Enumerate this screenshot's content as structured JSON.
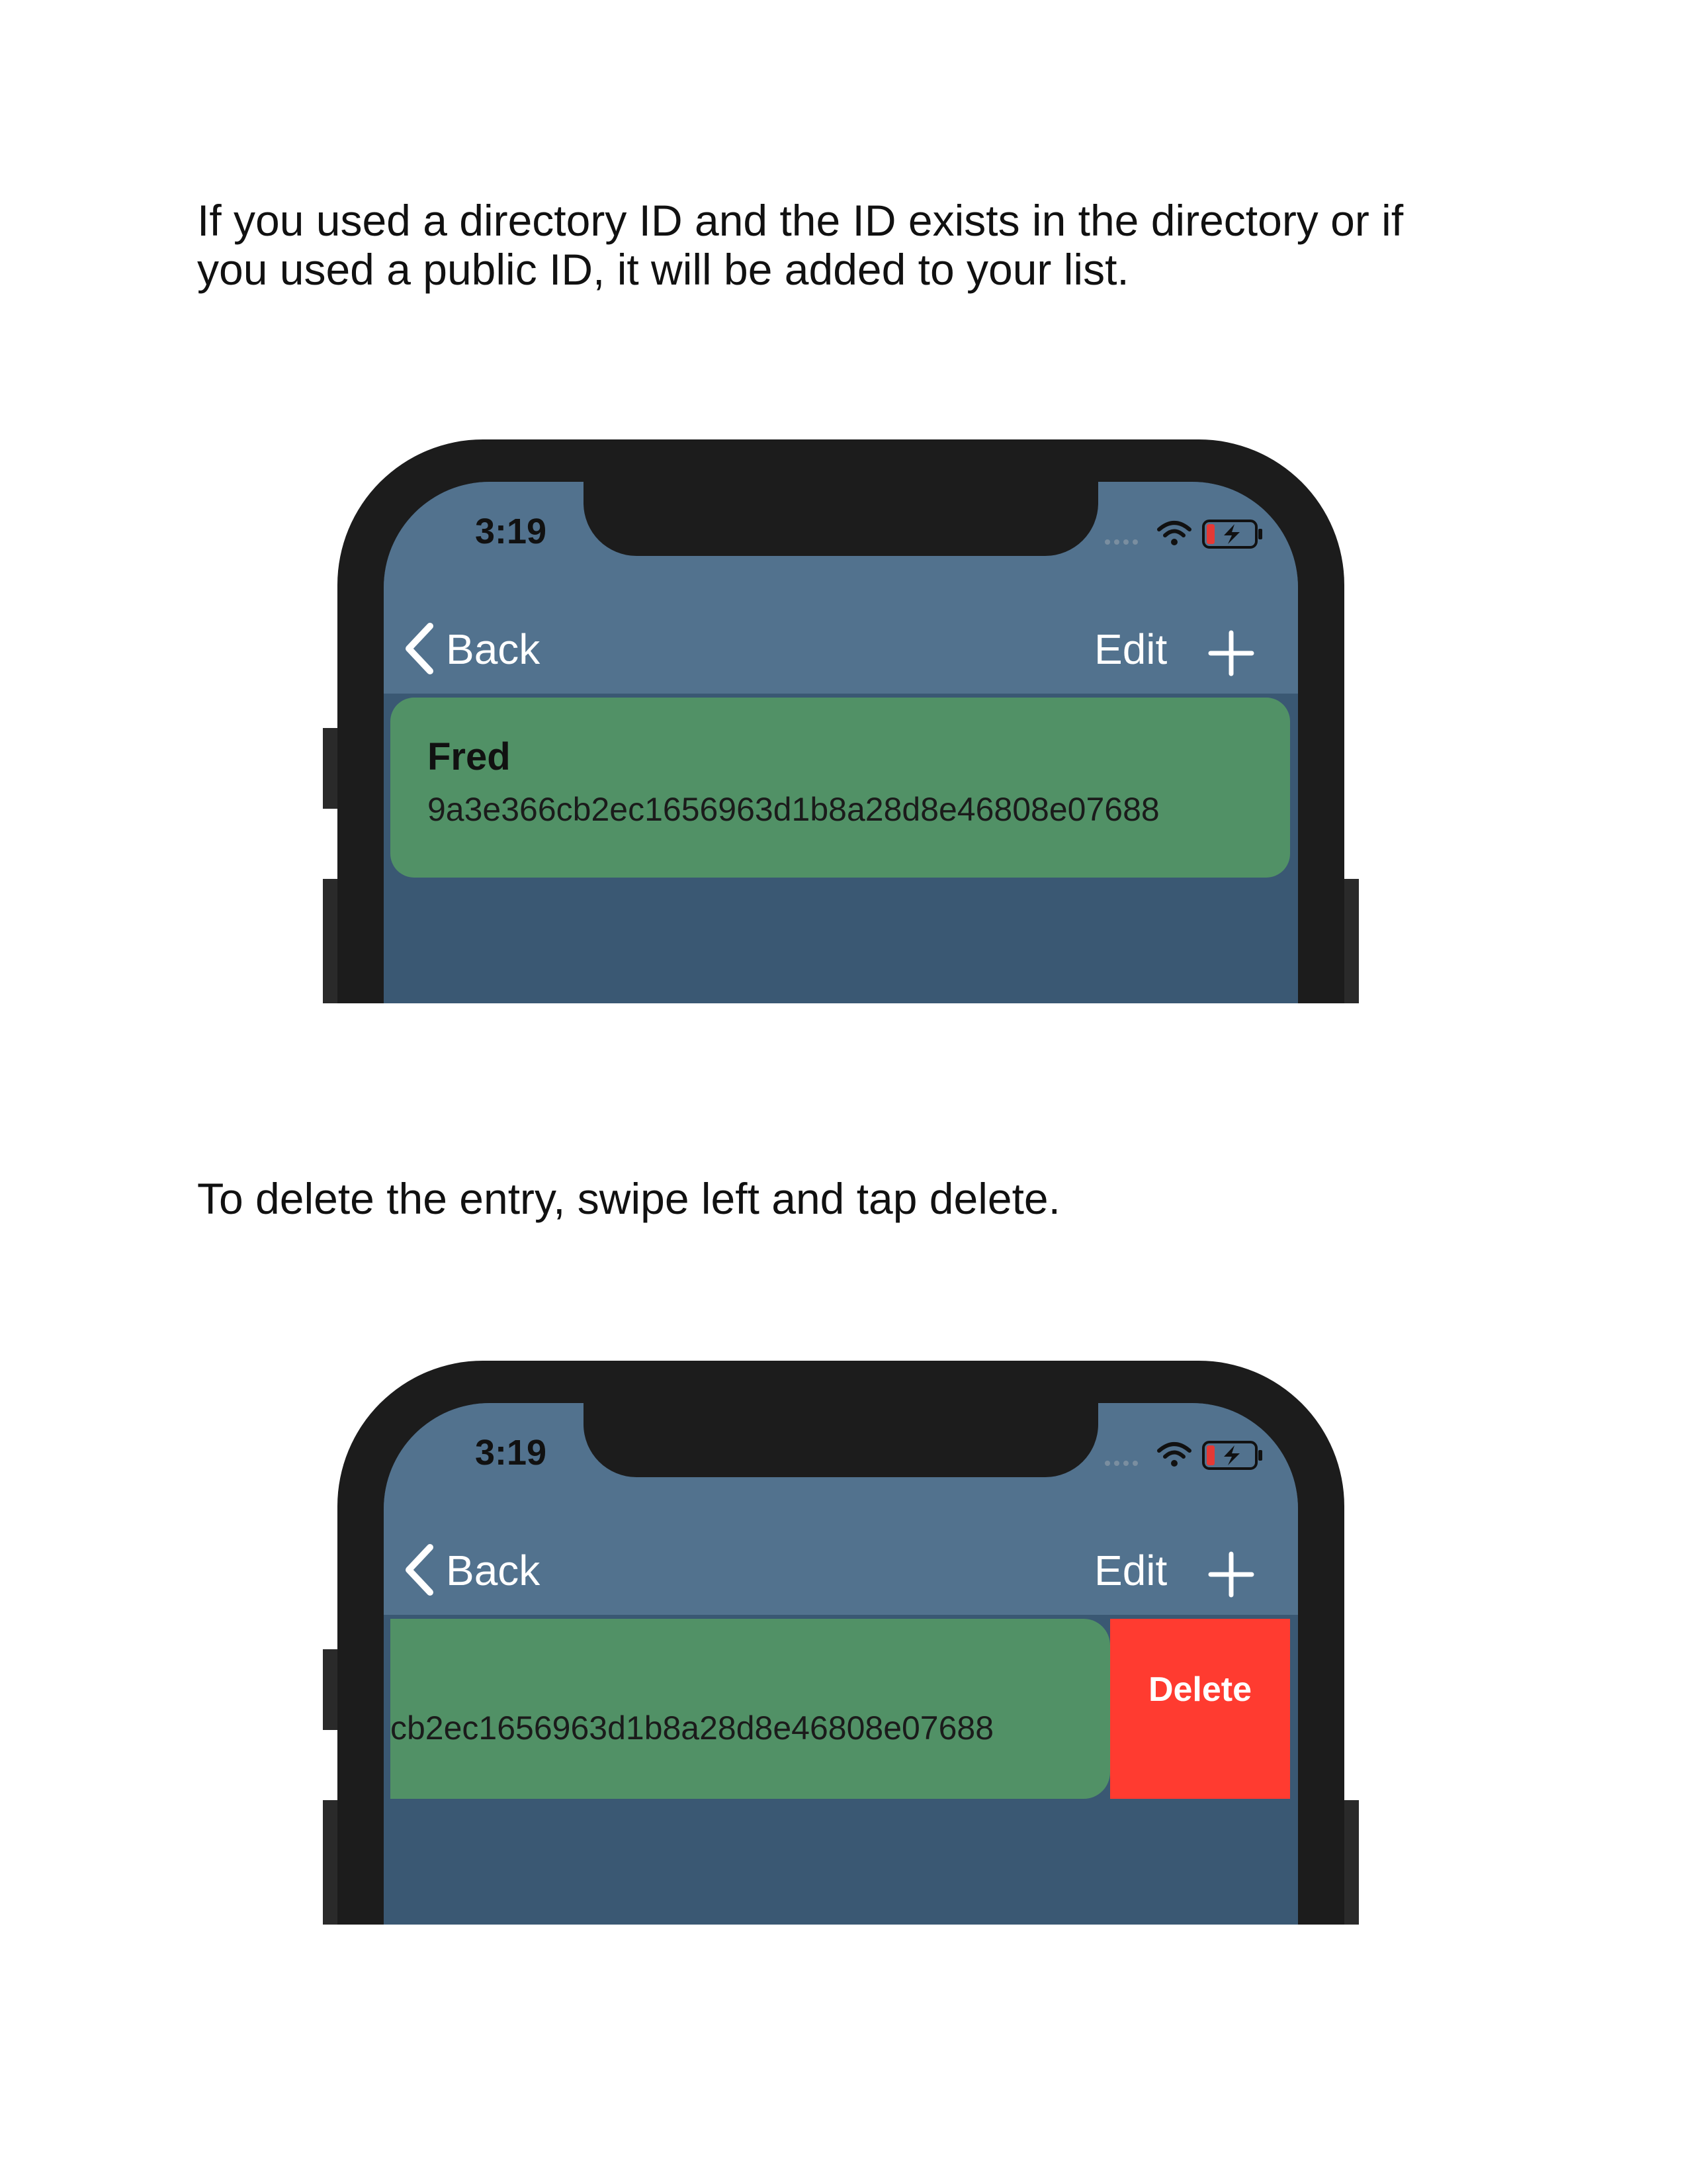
{
  "instructions": {
    "step1_line1": "If you used a directory ID and the ID exists in the directory or if",
    "step1_line2": "you used a public ID, it will be added to your list.",
    "step2": "To delete the entry, swipe left and tap delete."
  },
  "phone1": {
    "status_time": "3:19",
    "nav": {
      "back_label": "Back",
      "edit_label": "Edit"
    },
    "entry": {
      "name": "Fred",
      "id": "9a3e366cb2ec1656963d1b8a28d8e46808e07688"
    }
  },
  "phone2": {
    "status_time": "3:19",
    "nav": {
      "back_label": "Back",
      "edit_label": "Edit"
    },
    "entry": {
      "id_visible": "cb2ec1656963d1b8a28d8e46808e07688"
    },
    "delete_label": "Delete"
  },
  "colors": {
    "nav_bar": "#52728e",
    "list_background": "#3a5873",
    "entry_cell": "#519166",
    "delete_action": "#ff3b30",
    "phone_frame": "#1c1c1c"
  },
  "icons": {
    "back": "chevron-left-icon",
    "add": "plus-icon",
    "wifi": "wifi-icon",
    "battery": "battery-charging-icon",
    "signal": "signal-dots-icon"
  }
}
